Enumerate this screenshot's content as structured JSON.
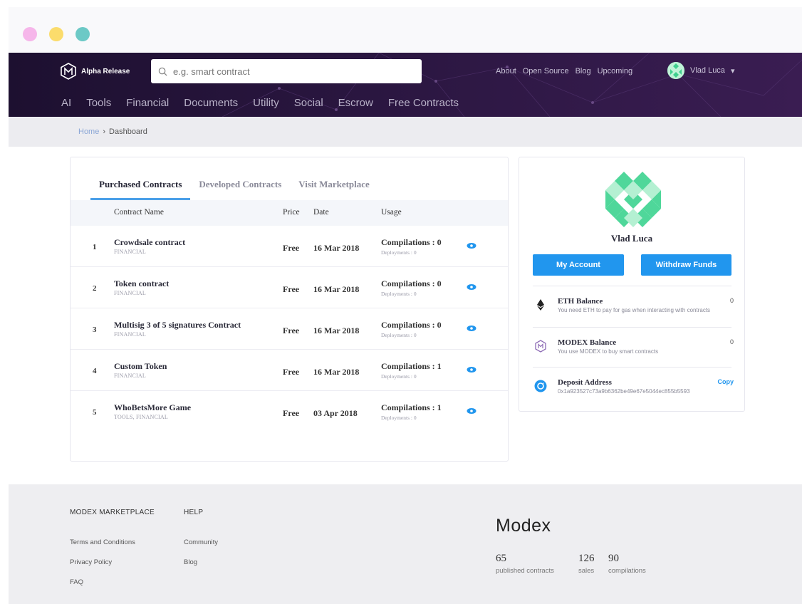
{
  "header": {
    "logo_text": "Alpha Release",
    "search_placeholder": "e.g. smart contract",
    "top_links": [
      "About",
      "Open Source",
      "Blog",
      "Upcoming"
    ],
    "user_name": "Vlad Luca",
    "categories": [
      "AI",
      "Tools",
      "Financial",
      "Documents",
      "Utility",
      "Social",
      "Escrow",
      "Free Contracts"
    ]
  },
  "breadcrumb": {
    "home": "Home",
    "separator": "›",
    "current": "Dashboard"
  },
  "tabs": [
    "Purchased Contracts",
    "Developed Contracts",
    "Visit Marketplace"
  ],
  "table": {
    "columns": [
      "Contract Name",
      "Price",
      "Date",
      "Usage"
    ],
    "rows": [
      {
        "num": "1",
        "name": "Crowdsale contract",
        "category": "FINANCIAL",
        "price": "Free",
        "date": "16 Mar 2018",
        "compilations": "Compilations : 0",
        "deployments": "Deployments : 0"
      },
      {
        "num": "2",
        "name": "Token contract",
        "category": "FINANCIAL",
        "price": "Free",
        "date": "16 Mar 2018",
        "compilations": "Compilations : 0",
        "deployments": "Deployments : 0"
      },
      {
        "num": "3",
        "name": "Multisig 3 of 5 signatures Contract",
        "category": "FINANCIAL",
        "price": "Free",
        "date": "16 Mar 2018",
        "compilations": "Compilations : 0",
        "deployments": "Deployments : 0"
      },
      {
        "num": "4",
        "name": "Custom Token",
        "category": "FINANCIAL",
        "price": "Free",
        "date": "16 Mar 2018",
        "compilations": "Compilations : 1",
        "deployments": "Deployments : 0"
      },
      {
        "num": "5",
        "name": "WhoBetsMore Game",
        "category": "TOOLS, FINANCIAL",
        "price": "Free",
        "date": "03 Apr 2018",
        "compilations": "Compilations : 1",
        "deployments": "Deployments : 0"
      }
    ]
  },
  "profile": {
    "name": "Vlad Luca",
    "my_account": "My Account",
    "withdraw": "Withdraw Funds",
    "eth_title": "ETH Balance",
    "eth_desc": "You need ETH to pay for gas when interacting with contracts",
    "eth_value": "0",
    "modex_title": "MODEX Balance",
    "modex_desc": "You use MODEX to buy smart contracts",
    "modex_value": "0",
    "deposit_title": "Deposit Address",
    "deposit_address": "0x1a923527c73a9b6362be49e67e5044ec855b5593",
    "copy_label": "Copy"
  },
  "footer": {
    "col1_title": "MODEX MARKETPLACE",
    "col2_title": "HELP",
    "col1_links": [
      "Terms and Conditions",
      "Privacy Policy",
      "FAQ"
    ],
    "col2_links": [
      "Community",
      "Blog"
    ],
    "brand": "Modex",
    "stats": [
      {
        "value": "65",
        "label": "published contracts"
      },
      {
        "value": "126",
        "label": "sales"
      },
      {
        "value": "90",
        "label": "compilations"
      }
    ]
  },
  "colors": {
    "accent": "#2196ee",
    "header_bg": "#2a1640",
    "brand_green": "#4fd79a"
  }
}
